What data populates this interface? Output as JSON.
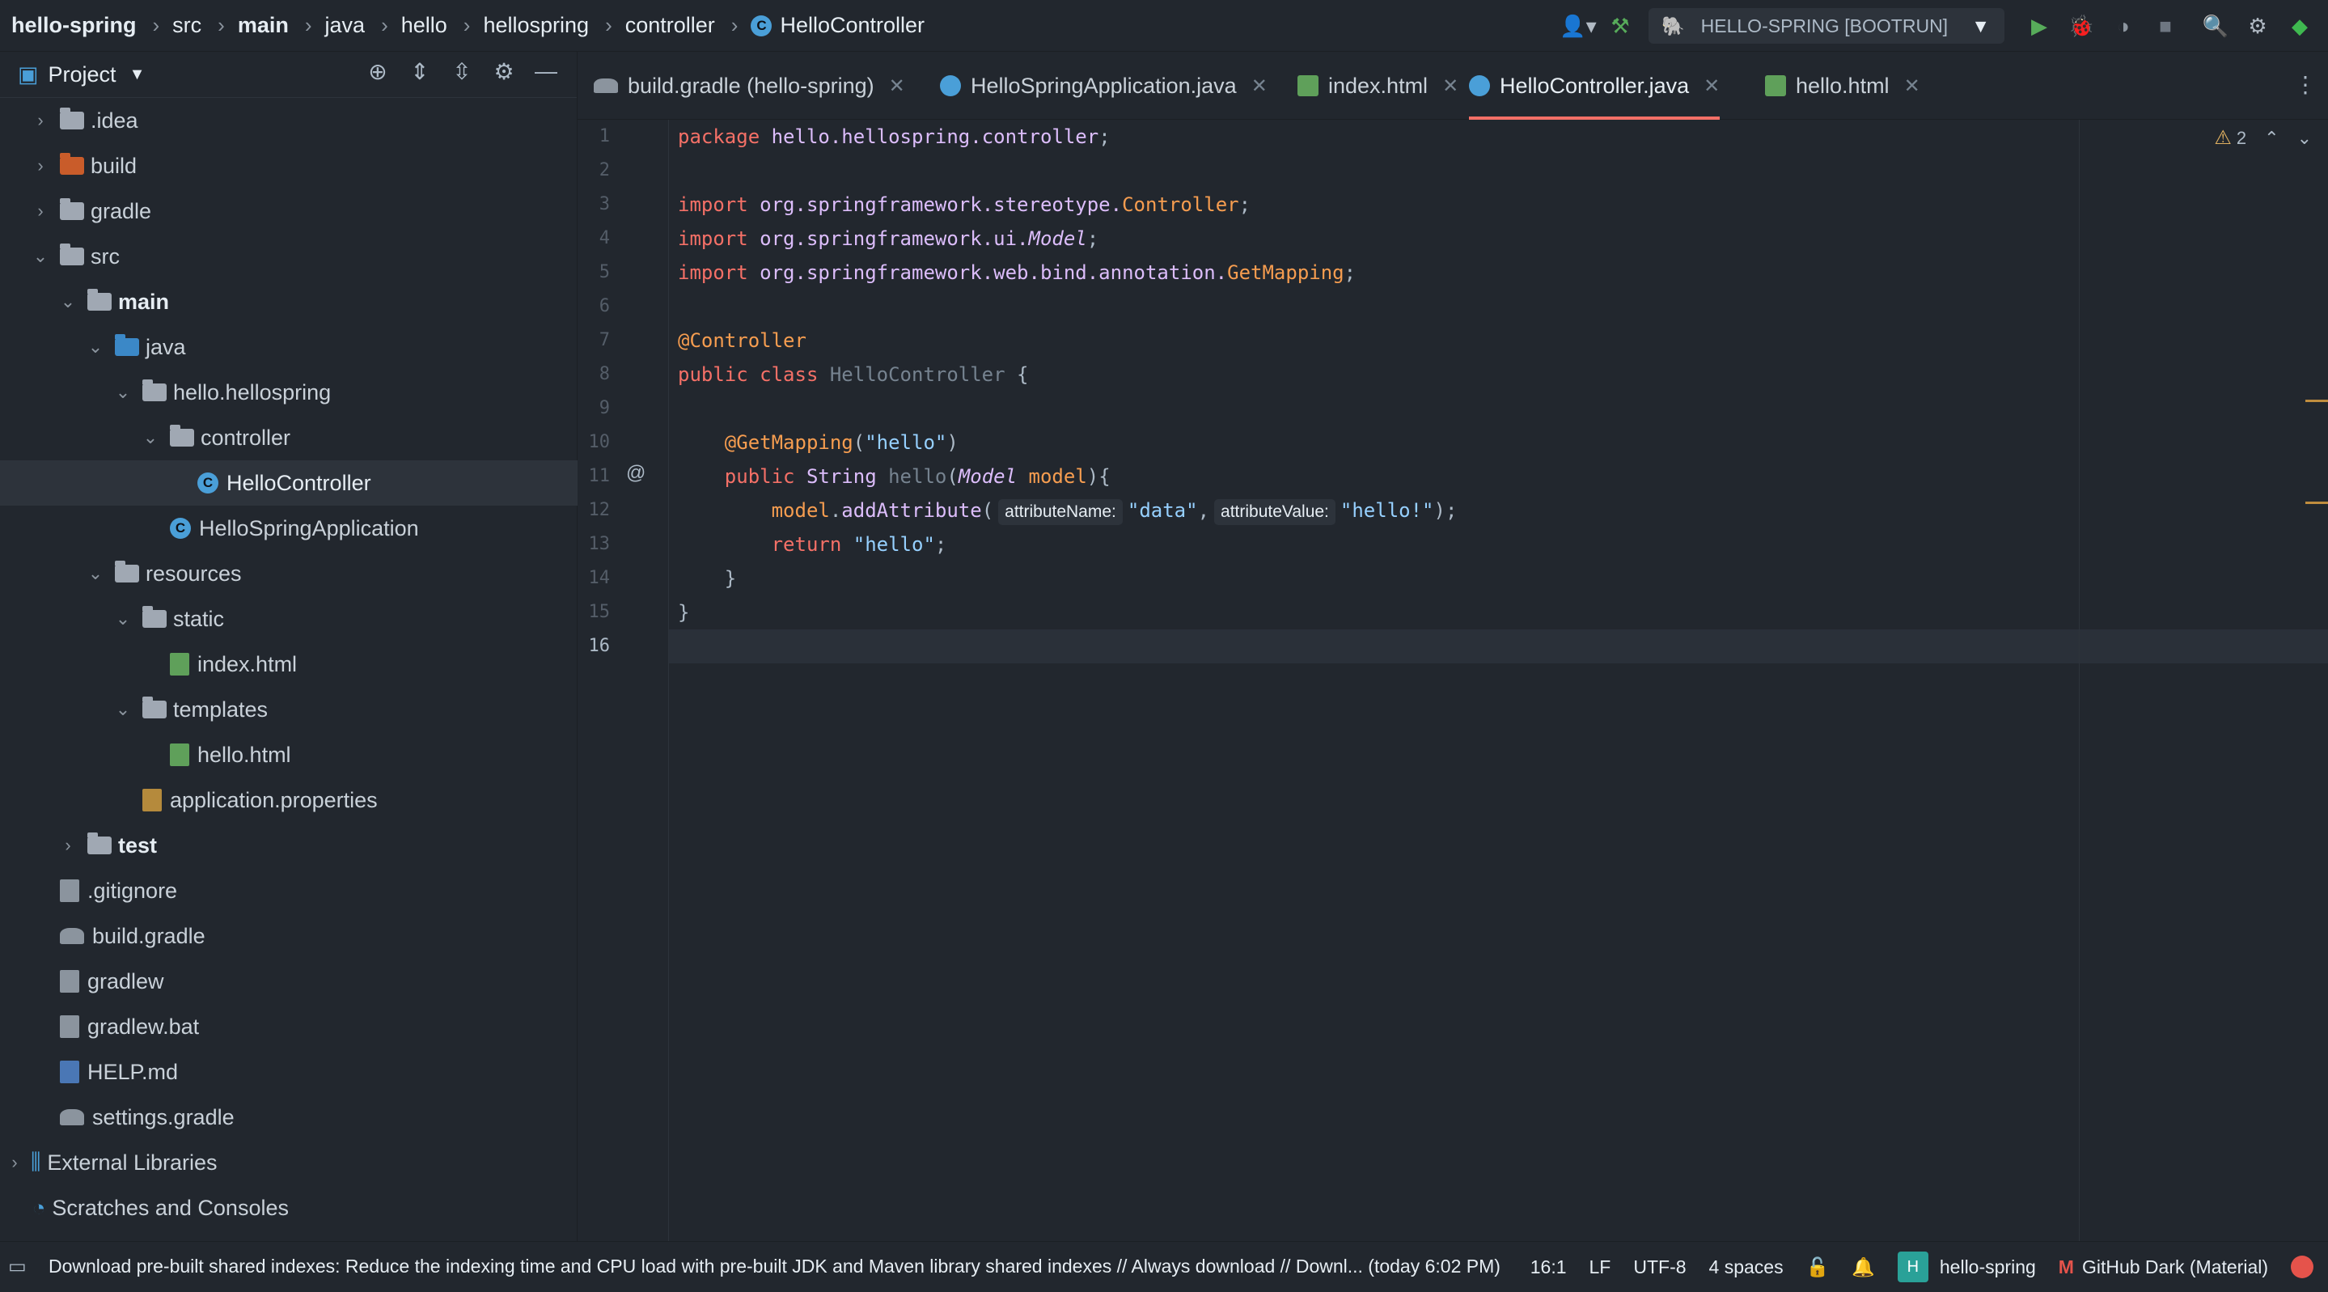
{
  "breadcrumb": {
    "items": [
      "hello-spring",
      "src",
      "main",
      "java",
      "hello",
      "hellospring",
      "controller",
      "HelloController"
    ]
  },
  "toolbar": {
    "run_config": "HELLO-SPRING [BOOTRUN]"
  },
  "project_panel": {
    "title": "Project",
    "tree": [
      {
        "label": ".idea"
      },
      {
        "label": "build"
      },
      {
        "label": "gradle"
      },
      {
        "label": "src"
      },
      {
        "label": "main"
      },
      {
        "label": "java"
      },
      {
        "label": "hello.hellospring"
      },
      {
        "label": "controller"
      },
      {
        "label": "HelloController"
      },
      {
        "label": "HelloSpringApplication"
      },
      {
        "label": "resources"
      },
      {
        "label": "static"
      },
      {
        "label": "index.html"
      },
      {
        "label": "templates"
      },
      {
        "label": "hello.html"
      },
      {
        "label": "application.properties"
      },
      {
        "label": "test"
      },
      {
        "label": ".gitignore"
      },
      {
        "label": "build.gradle"
      },
      {
        "label": "gradlew"
      },
      {
        "label": "gradlew.bat"
      },
      {
        "label": "HELP.md"
      },
      {
        "label": "settings.gradle"
      },
      {
        "label": "External Libraries"
      },
      {
        "label": "Scratches and Consoles"
      }
    ]
  },
  "tabs": [
    {
      "label": "build.gradle (hello-spring)"
    },
    {
      "label": "HelloSpringApplication.java"
    },
    {
      "label": "index.html"
    },
    {
      "label": "HelloController.java"
    },
    {
      "label": "hello.html"
    }
  ],
  "editor": {
    "line_numbers": [
      "1",
      "2",
      "3",
      "4",
      "5",
      "6",
      "7",
      "8",
      "9",
      "10",
      "11",
      "12",
      "13",
      "14",
      "15",
      "16"
    ],
    "current_line": 16,
    "warnings_count": "2",
    "code": {
      "l1_kw": "package",
      "l1_pkg": "hello.hellospring.controller",
      "l1_end": ";",
      "l3_kw": "import",
      "l3_pkg": "org.springframework.stereotype.",
      "l3_cls": "Controller",
      "l3_end": ";",
      "l4_kw": "import",
      "l4_pkg": "org.springframework.ui.",
      "l4_cls": "Model",
      "l4_end": ";",
      "l5_kw": "import",
      "l5_pkg": "org.springframework.web.bind.annotation.",
      "l5_cls": "GetMapping",
      "l5_end": ";",
      "l7_ann": "@Controller",
      "l8_kw": "public class",
      "l8_name": "HelloController",
      "l8_end": "{",
      "l10_ann": "@GetMapping",
      "l10_open": "(",
      "l10_str": "\"hello\"",
      "l10_close": ")",
      "l11_kw": "public",
      "l11_type": "String",
      "l11_fn": "hello",
      "l11_open": "(",
      "l11_ptype": "Model",
      "l11_param": "model",
      "l11_end": "){",
      "l12_var": "model",
      "l12_dot": ".",
      "l12_method": "addAttribute",
      "l12_open": "(",
      "l12_hint1": "attributeName:",
      "l12_str1": "\"data\"",
      "l12_comma": ",",
      "l12_hint2": "attributeValue:",
      "l12_str2": "\"hello!\"",
      "l12_end": ");",
      "l13_kw": "return",
      "l13_str": "\"hello\"",
      "l13_end": ";",
      "l14": "}",
      "l15": "}",
      "at_mark": "@"
    }
  },
  "statusbar": {
    "message": "Download pre-built shared indexes: Reduce the indexing time and CPU load with pre-built JDK and Maven library shared indexes // Always download // Downl... (today 6:02 PM)",
    "position": "16:1",
    "line_ending": "LF",
    "encoding": "UTF-8",
    "indent": "4 spaces",
    "project_badge": "H",
    "project": "hello-spring",
    "theme": "GitHub Dark (Material)"
  }
}
